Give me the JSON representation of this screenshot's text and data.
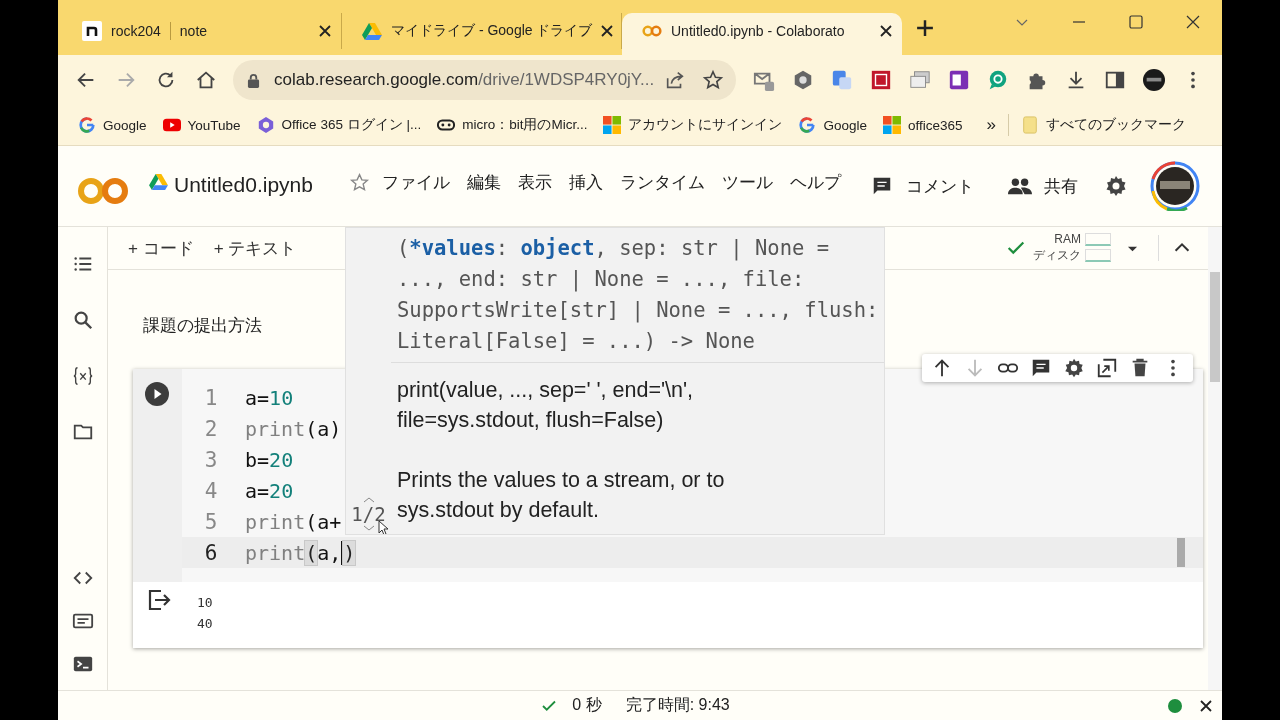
{
  "browser": {
    "tabs": [
      {
        "title": "rock204",
        "subtitle": "note",
        "selected": false
      },
      {
        "title": "マイドライブ - Google ドライブ",
        "selected": false
      },
      {
        "title": "Untitled0.ipynb - Colaborato",
        "selected": true
      }
    ],
    "address": {
      "domain": "colab.research.google.com",
      "path": "/drive/1WDSP4RY0jY..."
    },
    "bookmarks": [
      {
        "label": "Google"
      },
      {
        "label": "YouTube"
      },
      {
        "label": "Office 365 ログイン |..."
      },
      {
        "label": "micro：bit用のMicr..."
      },
      {
        "label": "アカウントにサインイン"
      },
      {
        "label": "Google"
      },
      {
        "label": "office365"
      }
    ],
    "more_bookmarks": "»",
    "all_bookmarks": "すべてのブックマーク"
  },
  "notebook": {
    "title": "Untitled0.ipynb",
    "starred": false,
    "menu": [
      "ファイル",
      "編集",
      "表示",
      "挿入",
      "ランタイム",
      "ツール",
      "ヘルプ"
    ],
    "comment": "コメント",
    "share": "共有",
    "toolbar": {
      "add_code": "+ コード",
      "add_text": "+ テキスト",
      "connected": true,
      "ram": "RAM",
      "disk": "ディスク"
    },
    "text_cell": "課題の提出方法",
    "code_cell": {
      "lines": [
        {
          "number": "1",
          "active": false,
          "tokens": [
            {
              "text": "a=",
              "kind": "var"
            },
            {
              "text": "10",
              "kind": "num"
            }
          ]
        },
        {
          "number": "2",
          "active": false,
          "tokens": [
            {
              "text": "print",
              "kind": "fn"
            },
            {
              "text": "(a)",
              "kind": "var"
            }
          ]
        },
        {
          "number": "3",
          "active": false,
          "tokens": [
            {
              "text": "b=",
              "kind": "var"
            },
            {
              "text": "20",
              "kind": "num"
            }
          ]
        },
        {
          "number": "4",
          "active": false,
          "tokens": [
            {
              "text": "a=",
              "kind": "var"
            },
            {
              "text": "20",
              "kind": "num"
            }
          ]
        },
        {
          "number": "5",
          "active": false,
          "tokens": [
            {
              "text": "print",
              "kind": "fn"
            },
            {
              "text": "(a+",
              "kind": "var"
            }
          ]
        },
        {
          "number": "6",
          "active": true,
          "tokens": [
            {
              "text": "print",
              "kind": "fn"
            },
            {
              "text": "(",
              "kind": "bracket"
            },
            {
              "text": "a,",
              "kind": "var"
            },
            {
              "text": ")",
              "kind": "bracket"
            }
          ]
        }
      ],
      "output": [
        "10",
        "40"
      ]
    },
    "tooltip": {
      "page": "1/2",
      "signature": [
        [
          {
            "text": "(",
            "kind": "plain"
          },
          {
            "text": "*values",
            "kind": "param"
          },
          {
            "text": ": ",
            "kind": "plain"
          },
          {
            "text": "object",
            "kind": "param"
          },
          {
            "text": ", sep: str | None =",
            "kind": "plain"
          }
        ],
        [
          {
            "text": "..., end: str | None = ..., file:",
            "kind": "plain"
          }
        ],
        [
          {
            "text": "SupportsWrite[str] | None = ..., flush:",
            "kind": "plain"
          }
        ],
        [
          {
            "text": "Literal[False] = ...) -> None",
            "kind": "plain"
          }
        ]
      ],
      "doc": [
        [
          "print(value, ..., sep=' ', end='\\n',",
          "file=sys.stdout, flush=False)"
        ],
        [
          "Prints the values to a stream, or to",
          "sys.stdout by default."
        ]
      ]
    }
  },
  "status": {
    "ok": true,
    "duration": "0 秒",
    "completed": "完了時間: 9:43",
    "connected": true
  }
}
